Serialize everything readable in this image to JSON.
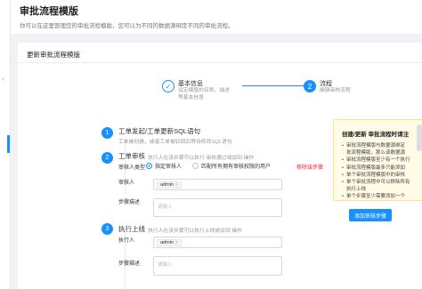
{
  "page": {
    "title": "审批流程模版",
    "description": "你可以在这里管理您的审批流程模版，您可以为不同的数据源绑定不同的审批流程。"
  },
  "card": {
    "title": "更新审批流程模版"
  },
  "steps": [
    {
      "index": "✓",
      "title": "基本信息",
      "desc1": "设定模版的名称、描述",
      "desc2": "等基本信息"
    },
    {
      "index": "2",
      "title": "流程",
      "desc1": "编辑审核流程"
    }
  ],
  "sections": {
    "s1": {
      "index": "1",
      "title": "工单发起/工单更新SQL语句",
      "desc": "工单被创建，或者工单被驳回后等待修改SQL语句"
    },
    "s2": {
      "index": "2",
      "title": "工单审核",
      "desc": "执行人在该步骤可以执行 审核通过或驳回 操作",
      "reviewer_type_label": "审核人类型",
      "radio_specified": "指定审核人",
      "radio_match": "匹配所有拥有审核权限的用户",
      "remove_link": "移除该步骤",
      "reviewer_label": "审核人",
      "reviewer_tag": "admin",
      "step_desc_label": "步骤描述",
      "step_desc_placeholder": "请输入"
    },
    "s3": {
      "index": "3",
      "title": "执行上线",
      "desc": "执行人在该步骤可以执行上线或驳回 操作",
      "executor_label": "执行人",
      "executor_tag": "admin",
      "step_desc_label": "步骤描述",
      "step_desc_placeholder": "请输入"
    }
  },
  "help": {
    "title": "创建/更新 审批流程时请注",
    "items": [
      {
        "bullet": true,
        "text": "审批流程模版与数据源绑定"
      },
      {
        "bullet": false,
        "text": "批流程模版，那么该数据源"
      },
      {
        "bullet": true,
        "text": "审批流程模版至少有一个执行"
      },
      {
        "bullet": true,
        "text": "审批流程模版最多只能添加"
      },
      {
        "bullet": true,
        "text": "单个审批流程模版中的审核"
      },
      {
        "bullet": true,
        "text": "单个审批流程中可以移除所有"
      },
      {
        "bullet": false,
        "text": "执行上线"
      },
      {
        "bullet": true,
        "text": "单个步骤至少需要添加一个"
      }
    ],
    "add_button": "添加审核步骤"
  }
}
